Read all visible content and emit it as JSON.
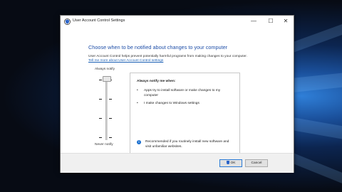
{
  "window": {
    "title": "User Account Control Settings",
    "minimize": "—",
    "maximize": "☐",
    "close": "✕"
  },
  "main": {
    "heading": "Choose when to be notified about changes to your computer",
    "description": "User Account Control helps prevent potentially harmful programs from making changes to your computer.",
    "link": "Tell me more about User Account Control settings",
    "slider": {
      "top_label": "Always notify",
      "bottom_label": "Never notify",
      "level_index": 0,
      "levels": 4
    }
  },
  "panel": {
    "heading": "Always notify me when:",
    "bullets": [
      "Apps try to install software or make changes to my computer",
      "I make changes to Windows settings"
    ],
    "bullet_glyph": "•",
    "recommendation": "Recommended if you routinely install new software and visit unfamiliar websites.",
    "info_glyph": "i"
  },
  "footer": {
    "ok_label": "OK",
    "cancel_label": "Cancel"
  },
  "colors": {
    "heading": "#1f4fa8",
    "link": "#1a5fb4",
    "accent": "#2b7bd6"
  }
}
